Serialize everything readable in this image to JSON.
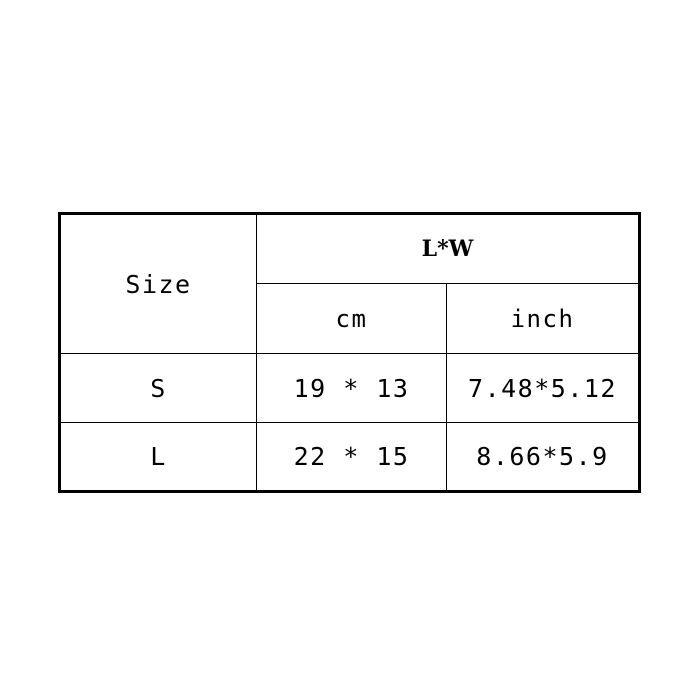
{
  "table": {
    "headers": {
      "size_label": "Size",
      "dimension_group": "L*W",
      "units": [
        "cm",
        "inch"
      ]
    },
    "rows": [
      {
        "size": "S",
        "cm": "19 * 13",
        "inch": "7.48*5.12"
      },
      {
        "size": "L",
        "cm": "22 * 15",
        "inch": "8.66*5.9"
      }
    ]
  },
  "colors": {
    "page_background": "#ffffff",
    "table_background": "#ffffff",
    "border": "#000000",
    "text": "#000000"
  }
}
